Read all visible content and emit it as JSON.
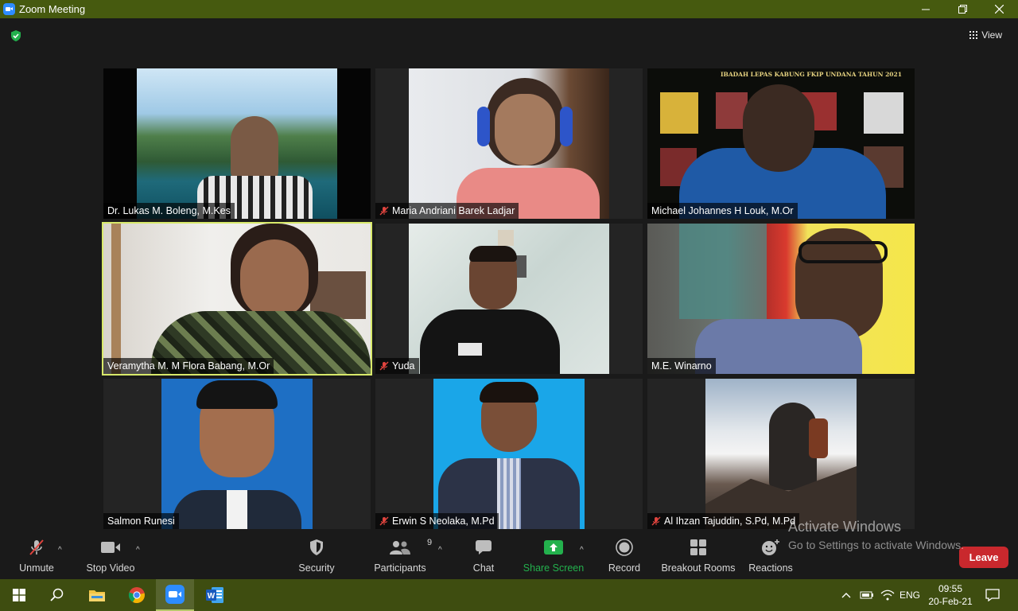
{
  "window": {
    "title": "Zoom Meeting",
    "controls": [
      "minimize-icon",
      "restore-icon",
      "close-icon"
    ]
  },
  "header": {
    "security_icon": "shield-check-icon",
    "view_label": "View"
  },
  "participants": [
    {
      "name": "Dr. Lukas M. Boleng, M.Kes",
      "muted": false
    },
    {
      "name": "Maria Andriani Barek  Ladjar",
      "muted": true
    },
    {
      "name": "Michael Johannes H Louk, M.Or",
      "muted": false
    },
    {
      "name": "Veramytha M. M Flora Babang, M.Or",
      "muted": false,
      "speaking": true
    },
    {
      "name": "Yuda",
      "muted": true
    },
    {
      "name": "M.E. Winarno",
      "muted": false
    },
    {
      "name": "Salmon Runesi",
      "muted": false
    },
    {
      "name": "Erwin S Neolaka, M.Pd",
      "muted": true
    },
    {
      "name": "Al Ihzan Tajuddin, S.Pd, M.Pd",
      "muted": true
    }
  ],
  "tile3_banner": "IBADAH LEPAS KABUNG FKIP UNDANA TAHUN 2021",
  "toolbar": {
    "unmute": "Unmute",
    "stop_video": "Stop Video",
    "security": "Security",
    "participants": "Participants",
    "participants_count": "9",
    "chat": "Chat",
    "share_screen": "Share Screen",
    "record": "Record",
    "breakout_rooms": "Breakout Rooms",
    "reactions": "Reactions",
    "leave": "Leave"
  },
  "watermark": {
    "title": "Activate Windows",
    "subtitle": "Go to Settings to activate Windows."
  },
  "taskbar": {
    "apps": [
      "windows-start-icon",
      "search-icon",
      "file-explorer-icon",
      "chrome-icon",
      "zoom-icon",
      "word-icon"
    ],
    "language": "ENG",
    "time": "09:55",
    "date": "20-Feb-21"
  },
  "colors": {
    "titlebar": "#465a0f",
    "taskbar": "#3e4d10",
    "active_speaker": "#d8e96a",
    "share_green": "#23b14d",
    "leave_red": "#c9282d"
  }
}
